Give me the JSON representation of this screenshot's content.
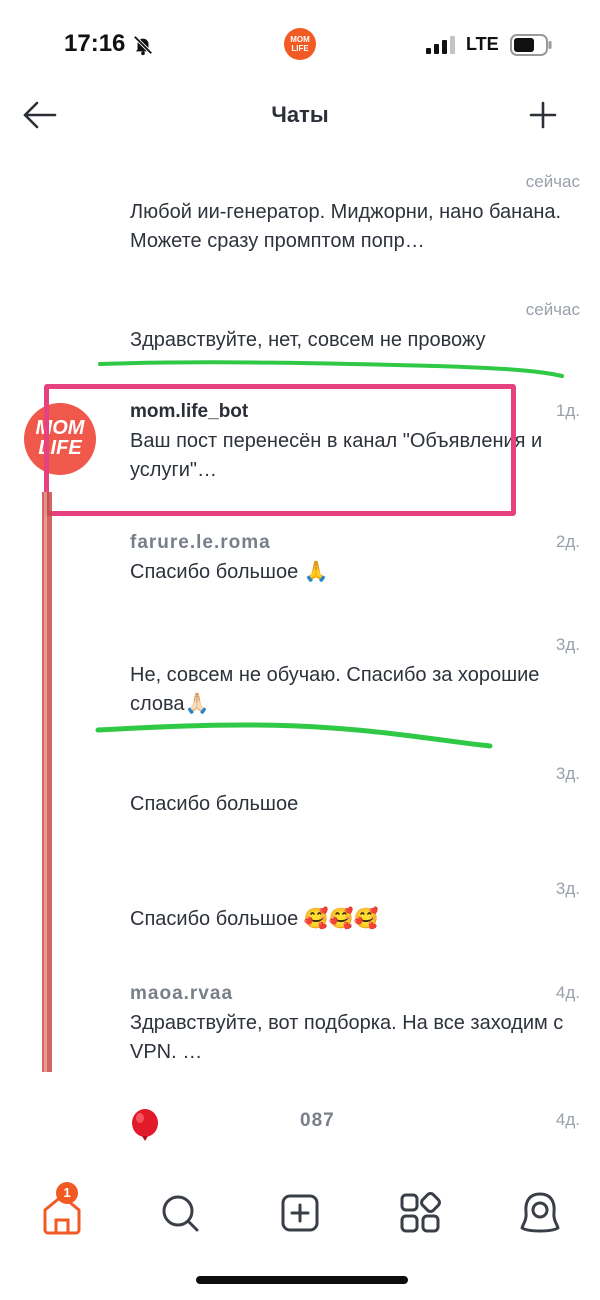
{
  "status_bar": {
    "time": "17:16",
    "network": "LTE",
    "app_badge_text": "MOM LIFE",
    "accent_color": "#f25a24"
  },
  "header": {
    "title": "Чаты",
    "back_icon": "arrow-left-icon",
    "add_icon": "plus-icon"
  },
  "chats": [
    {
      "name": "",
      "time": "сейчас",
      "preview": "Любой ии-генератор. Миджорни, нано банана. Можете сразу промптом попр…"
    },
    {
      "name": "",
      "time": "сейчас",
      "preview": "Здравствуйте, нет, совсем не провожу"
    },
    {
      "name": "mom.life_bot",
      "time": "1д.",
      "preview": "Ваш пост перенесён в канал \"Объявления и услуги\"…",
      "avatar_text": "MOM LIFE"
    },
    {
      "name": "farure.le.roma",
      "time": "2д.",
      "preview": "Спасибо большое 🙏"
    },
    {
      "name": "",
      "time": "3д.",
      "preview": "Не, совсем не обучаю. Спасибо за хорошие слова🙏🏻"
    },
    {
      "name": "",
      "time": "3д.",
      "preview": "Спасибо большое"
    },
    {
      "name": "",
      "time": "3д.",
      "preview": "Спасибо большое 🥰🥰🥰"
    },
    {
      "name": "maoa.rvaa",
      "time": "4д.",
      "preview": "Здравствуйте, вот подборка. На все заходим с VPN. …"
    },
    {
      "name": "087",
      "time": "4д.",
      "preview": ""
    }
  ],
  "bottom_nav": {
    "items": [
      "home-icon",
      "search-icon",
      "add-post-icon",
      "categories-icon",
      "profile-icon"
    ],
    "home_badge": "1"
  },
  "annotations": {
    "highlight_color": "#e5427f",
    "underline_color": "#2fc945"
  }
}
